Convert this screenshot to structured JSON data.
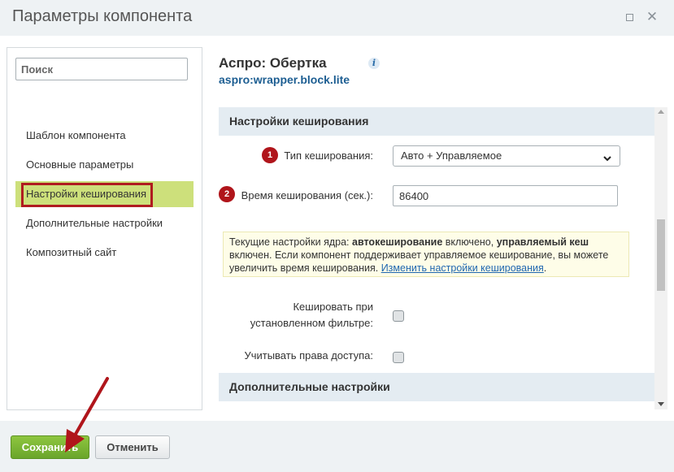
{
  "window": {
    "title": "Параметры компонента",
    "maximize_icon": "maximize-icon",
    "close_icon": "close-icon",
    "close_glyph": "✕"
  },
  "sidebar": {
    "search_placeholder": "Поиск",
    "items": [
      {
        "label": "Шаблон компонента",
        "active": false
      },
      {
        "label": "Основные параметры",
        "active": false
      },
      {
        "label": "Настройки кеширования",
        "active": true
      },
      {
        "label": "Дополнительные настройки",
        "active": false
      },
      {
        "label": "Композитный сайт",
        "active": false
      }
    ]
  },
  "component": {
    "title": "Аспро: Обертка",
    "code": "aspro:wrapper.block.lite",
    "info_glyph": "i"
  },
  "caching_section": {
    "heading": "Настройки кеширования",
    "cache_type": {
      "badge": "1",
      "label": "Тип кеширования:",
      "value": "Авто + Управляемое"
    },
    "cache_time": {
      "badge": "2",
      "label": "Время кеширования (сек.):",
      "value": "86400"
    },
    "notice": {
      "prefix": "Текущие настройки ядра: ",
      "bold1": "автокеширование",
      "mid1": " включено, ",
      "bold2": "управляемый кеш",
      "mid2": " включен. Если компонент поддерживает управляемое кеширование, вы можете увеличить время кеширования. ",
      "link": "Изменить настройки кеширования",
      "suffix": "."
    },
    "cache_filter": {
      "label_line1": "Кешировать при",
      "label_line2": "установленном фильтре:",
      "checked": false
    },
    "access_rights": {
      "label": "Учитывать права доступа:",
      "checked": false
    }
  },
  "additional_section": {
    "heading": "Дополнительные настройки"
  },
  "footer": {
    "save_label": "Сохранить",
    "cancel_label": "Отменить"
  },
  "colors": {
    "active_nav": "#cde07b",
    "highlight_border": "#b01c20",
    "save_button": "#7bb534",
    "badge": "#b0151b",
    "annotation_arrow": "#b0151b"
  }
}
